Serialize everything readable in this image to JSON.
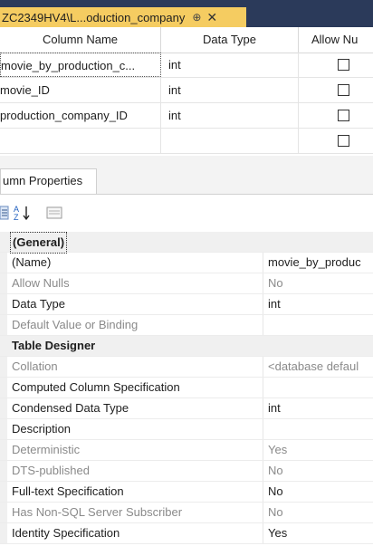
{
  "tab": {
    "title": "ZC2349HV4\\L...oduction_company",
    "pin_glyph": "⊕",
    "close_glyph": "✕"
  },
  "grid": {
    "headers": [
      "Column Name",
      "Data Type",
      "Allow Nu"
    ],
    "rows": [
      {
        "name": "movie_by_production_c...",
        "type": "int",
        "allow_nulls": false
      },
      {
        "name": "movie_ID",
        "type": "int",
        "allow_nulls": false
      },
      {
        "name": "production_company_ID",
        "type": "int",
        "allow_nulls": false
      },
      {
        "name": "",
        "type": "",
        "allow_nulls": false
      }
    ]
  },
  "properties_panel": {
    "tab_label": "umn Properties",
    "toolbar": {
      "categorized_icon": "categorized-icon",
      "alphabetical_icon": "sort-az-icon",
      "property_pages_icon": "property-pages-icon"
    },
    "rows": [
      {
        "name": "(General)",
        "value": "",
        "kind": "category-general"
      },
      {
        "name": "(Name)",
        "value": "movie_by_produc",
        "kind": "normal"
      },
      {
        "name": "Allow Nulls",
        "value": "No",
        "kind": "muted"
      },
      {
        "name": "Data Type",
        "value": "int",
        "kind": "normal"
      },
      {
        "name": "Default Value or Binding",
        "value": "",
        "kind": "muted"
      },
      {
        "name": "Table Designer",
        "value": "",
        "kind": "category"
      },
      {
        "name": "Collation",
        "value": "<database defaul",
        "kind": "muted"
      },
      {
        "name": "Computed Column Specification",
        "value": "",
        "kind": "normal"
      },
      {
        "name": "Condensed Data Type",
        "value": "int",
        "kind": "normal"
      },
      {
        "name": "Description",
        "value": "",
        "kind": "normal"
      },
      {
        "name": "Deterministic",
        "value": "Yes",
        "kind": "muted"
      },
      {
        "name": "DTS-published",
        "value": "No",
        "kind": "muted"
      },
      {
        "name": "Full-text Specification",
        "value": "No",
        "kind": "normal"
      },
      {
        "name": "Has Non-SQL Server Subscriber",
        "value": "No",
        "kind": "muted"
      },
      {
        "name": "Identity Specification",
        "value": "Yes",
        "kind": "normal"
      }
    ]
  },
  "colors": {
    "tab_active": "#f5cc61",
    "tab_bar": "#2b3a5a",
    "category_bg": "#f0f0f0",
    "muted_text": "#8a8a8a"
  }
}
